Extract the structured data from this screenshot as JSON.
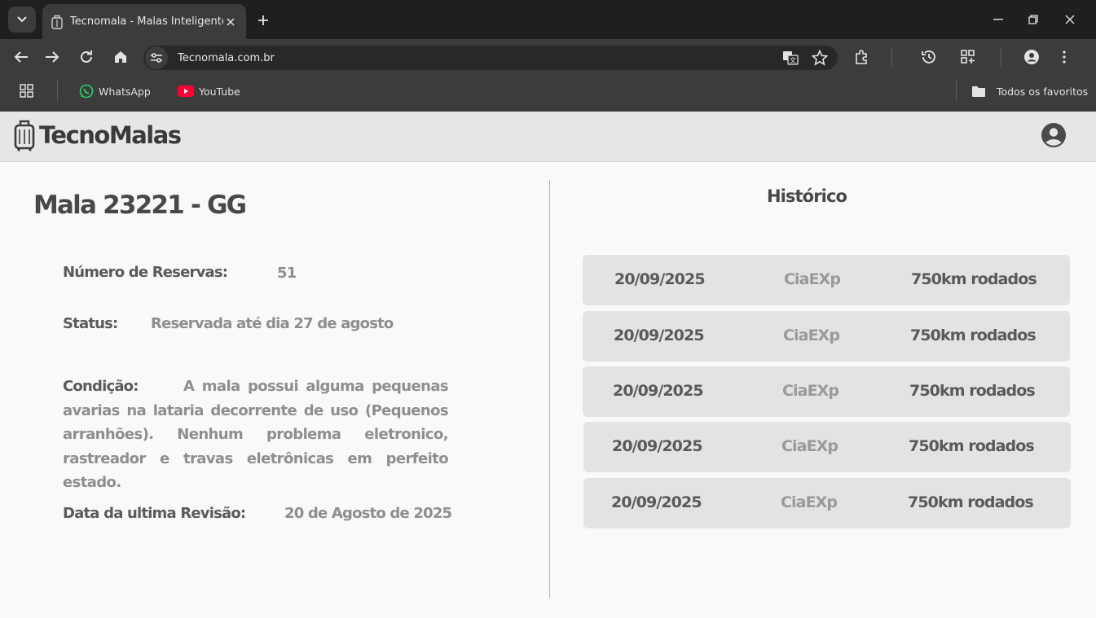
{
  "browser": {
    "tab_title": "Tecnomala - Malas Inteligentes",
    "url": "Tecnomala.com.br",
    "bookmarks": [
      {
        "label": "WhatsApp",
        "icon": "whatsapp-icon",
        "color": "#25d366"
      },
      {
        "label": "YouTube",
        "icon": "youtube-icon",
        "color": "#ff0000"
      }
    ],
    "all_bookmarks": "Todos os favoritos"
  },
  "site": {
    "logo_text": "TecnoMalas"
  },
  "mala": {
    "title": "Mala 23221 - GG",
    "reservas_label": "Número de Reservas:",
    "reservas_value": "51",
    "status_label": "Status:",
    "status_value": "Reservada até dia 27 de agosto",
    "condicao_label": "Condição:",
    "condicao_value": "A mala possui alguma pequenas avarias na lataria decorrente de uso (Pequenos arranhões). Nenhum problema eletronico, rastreador e travas eletrônicas em perfeito estado.",
    "revisao_label": "Data da ultima Revisão:",
    "revisao_value": "20 de Agosto de 2025"
  },
  "historico": {
    "title": "Histórico",
    "rows": [
      {
        "date": "20/09/2025",
        "company": "CiaEXp",
        "km": "750km rodados"
      },
      {
        "date": "20/09/2025",
        "company": "CiaEXp",
        "km": "750km rodados"
      },
      {
        "date": "20/09/2025",
        "company": "CiaEXp",
        "km": "750km rodados"
      },
      {
        "date": "20/09/2025",
        "company": "CiaEXp",
        "km": "750km rodados"
      },
      {
        "date": "20/09/2025",
        "company": "CiaEXp",
        "km": "750km rodados"
      }
    ]
  }
}
